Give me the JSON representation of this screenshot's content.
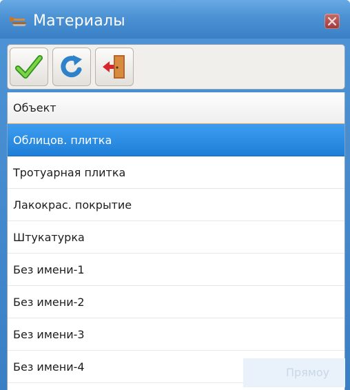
{
  "window": {
    "title": "Материалы",
    "accent": "#3a80c6",
    "app_icon": "hammer-saw-icon",
    "close_icon": "close-icon"
  },
  "toolbar": {
    "buttons": [
      {
        "name": "confirm",
        "icon": "checkmark-icon"
      },
      {
        "name": "refresh",
        "icon": "refresh-icon"
      },
      {
        "name": "exit",
        "icon": "exit-door-icon"
      }
    ]
  },
  "list": {
    "header": "Объект",
    "selected_color": "#1e7fd8",
    "items": [
      "Облицов. плитка",
      "Тротуарная плитка",
      "Лакокрас. покрытие",
      "Штукатурка",
      "Без имени-1",
      "Без имени-2",
      "Без имени-3",
      "Без имени-4"
    ],
    "selected_index": 0
  },
  "overlay": {
    "text": "Прямоу"
  }
}
